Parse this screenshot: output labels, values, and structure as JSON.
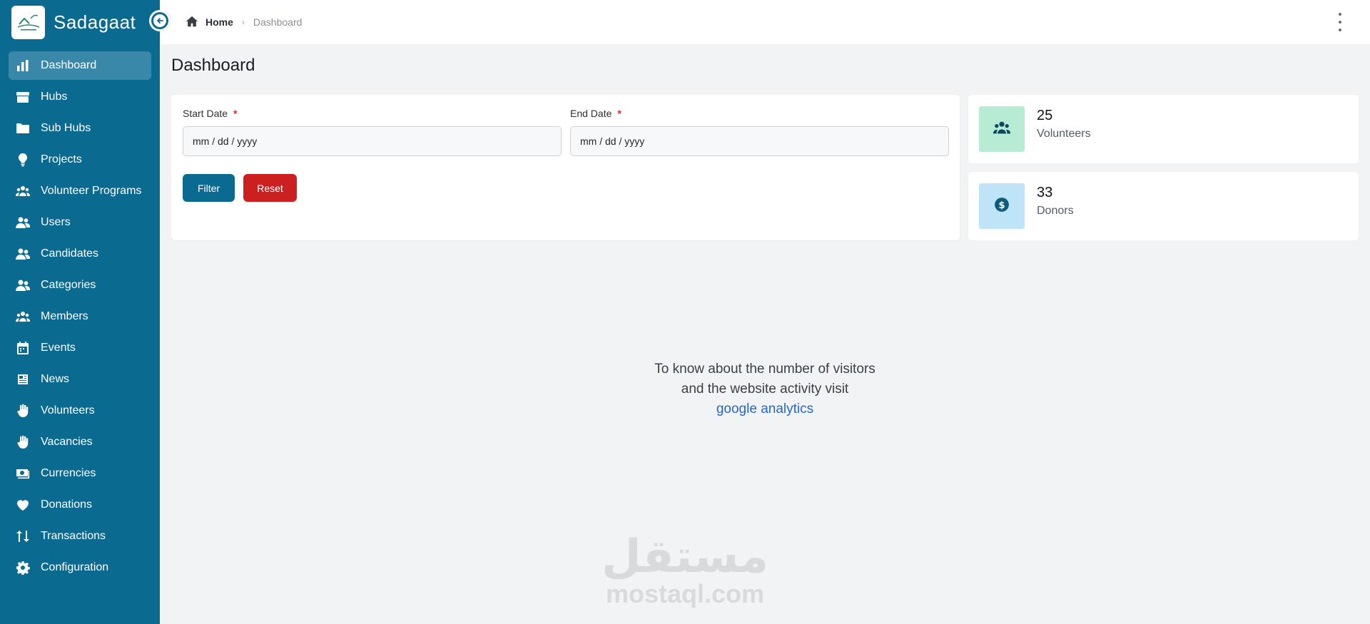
{
  "brand": {
    "name": "Sadagaat"
  },
  "colors": {
    "sidebar": "#0b6a8f",
    "active_item": "#3a88a9",
    "filter": "#0b6a8f",
    "reset": "#cc1f1f",
    "volunteers_tile": "#b7ebd3",
    "donors_tile": "#bfe4f8"
  },
  "sidebar": {
    "items": [
      {
        "label": "Dashboard",
        "icon": "chart-bar-icon"
      },
      {
        "label": "Hubs",
        "icon": "archive-icon"
      },
      {
        "label": "Sub Hubs",
        "icon": "folder-icon"
      },
      {
        "label": "Projects",
        "icon": "lightbulb-icon"
      },
      {
        "label": "Volunteer Programs",
        "icon": "people-group-icon"
      },
      {
        "label": "Users",
        "icon": "user-group-icon"
      },
      {
        "label": "Candidates",
        "icon": "user-group-icon"
      },
      {
        "label": "Categories",
        "icon": "user-group-icon"
      },
      {
        "label": "Members",
        "icon": "people-group-icon"
      },
      {
        "label": "Events",
        "icon": "calendar-icon"
      },
      {
        "label": "News",
        "icon": "newspaper-icon"
      },
      {
        "label": "Volunteers",
        "icon": "hand-icon"
      },
      {
        "label": "Vacancies",
        "icon": "hand-icon"
      },
      {
        "label": "Currencies",
        "icon": "money-icon"
      },
      {
        "label": "Donations",
        "icon": "heart-icon"
      },
      {
        "label": "Transactions",
        "icon": "arrows-up-down-icon"
      },
      {
        "label": "Configuration",
        "icon": "gear-icon"
      }
    ]
  },
  "breadcrumb": {
    "home": "Home",
    "current": "Dashboard"
  },
  "page": {
    "title": "Dashboard"
  },
  "filter": {
    "start_label": "Start Date",
    "end_label": "End Date",
    "required_mark": "*",
    "start_value": "mm / dd / yyyy",
    "end_value": "mm / dd / yyyy",
    "filter_button": "Filter",
    "reset_button": "Reset"
  },
  "stats": {
    "volunteers": {
      "value": "25",
      "label": "Volunteers"
    },
    "donors": {
      "value": "33",
      "label": "Donors"
    }
  },
  "info": {
    "line1": "To know about the number of visitors",
    "line2": "and the website activity visit",
    "link": "google analytics"
  },
  "watermark": {
    "arabic": "مستقل",
    "latin": "mostaql.com"
  }
}
